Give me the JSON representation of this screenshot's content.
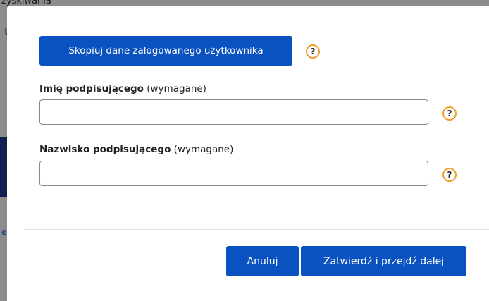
{
  "background": {
    "text_top": "zyskiwania",
    "text_heading": "u"
  },
  "dialog": {
    "copy_button_label": "Skopiuj dane zalogowanego użytkownika",
    "help_symbol": "?",
    "first_name": {
      "label": "Imię podpisującego",
      "required_note": "(wymagane)",
      "value": ""
    },
    "last_name": {
      "label": "Nazwisko podpisującego",
      "required_note": "(wymagane)",
      "value": ""
    },
    "cancel_label": "Anuluj",
    "confirm_label": "Zatwierdź i przejdź dalej"
  },
  "colors": {
    "primary": "#0a52bf",
    "help_ring": "#f0a030"
  }
}
